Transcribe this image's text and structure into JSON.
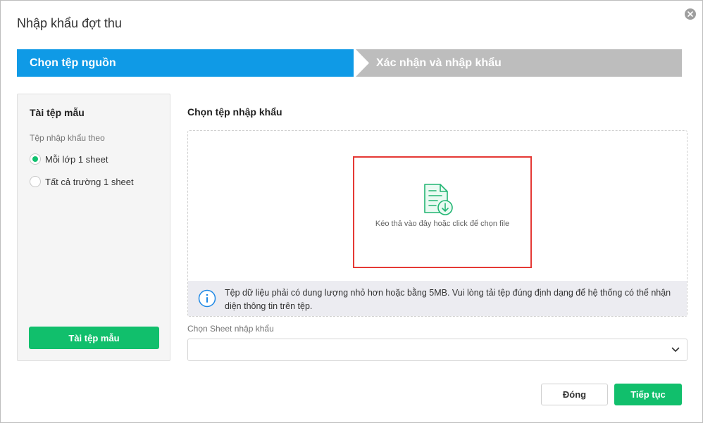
{
  "dialog": {
    "title": "Nhập khẩu đợt thu",
    "close_icon": "close-circle-icon"
  },
  "steps": [
    {
      "label": "Chọn tệp nguồn",
      "active": true
    },
    {
      "label": "Xác nhận và nhập khẩu",
      "active": false
    }
  ],
  "template_panel": {
    "title": "Tài tệp mẫu",
    "subtitle": "Tệp nhập khẩu theo",
    "options": [
      {
        "label": "Mỗi lớp 1 sheet",
        "checked": true
      },
      {
        "label": "Tất cả trường 1 sheet",
        "checked": false
      }
    ],
    "download_button": "Tài tệp mẫu"
  },
  "import": {
    "title": "Chọn tệp nhập khẩu",
    "drop_text": "Kéo thả vào đây hoặc click để chọn file",
    "file_icon": "file-download-icon",
    "info_icon": "info-icon",
    "info_text": "Tệp dữ liệu phải có dung lượng nhỏ hơn hoặc bằng 5MB. Vui lòng tải tệp đúng định dạng để hệ thống có thể nhận diện thông tin trên tệp."
  },
  "sheet_select": {
    "label": "Chọn Sheet nhập khẩu",
    "value": ""
  },
  "footer": {
    "close_label": "Đóng",
    "next_label": "Tiếp tục"
  },
  "colors": {
    "step_active": "#0f9ae6",
    "step_inactive": "#bdbdbd",
    "primary_green": "#11bf6c",
    "highlight_red": "#e53935"
  }
}
